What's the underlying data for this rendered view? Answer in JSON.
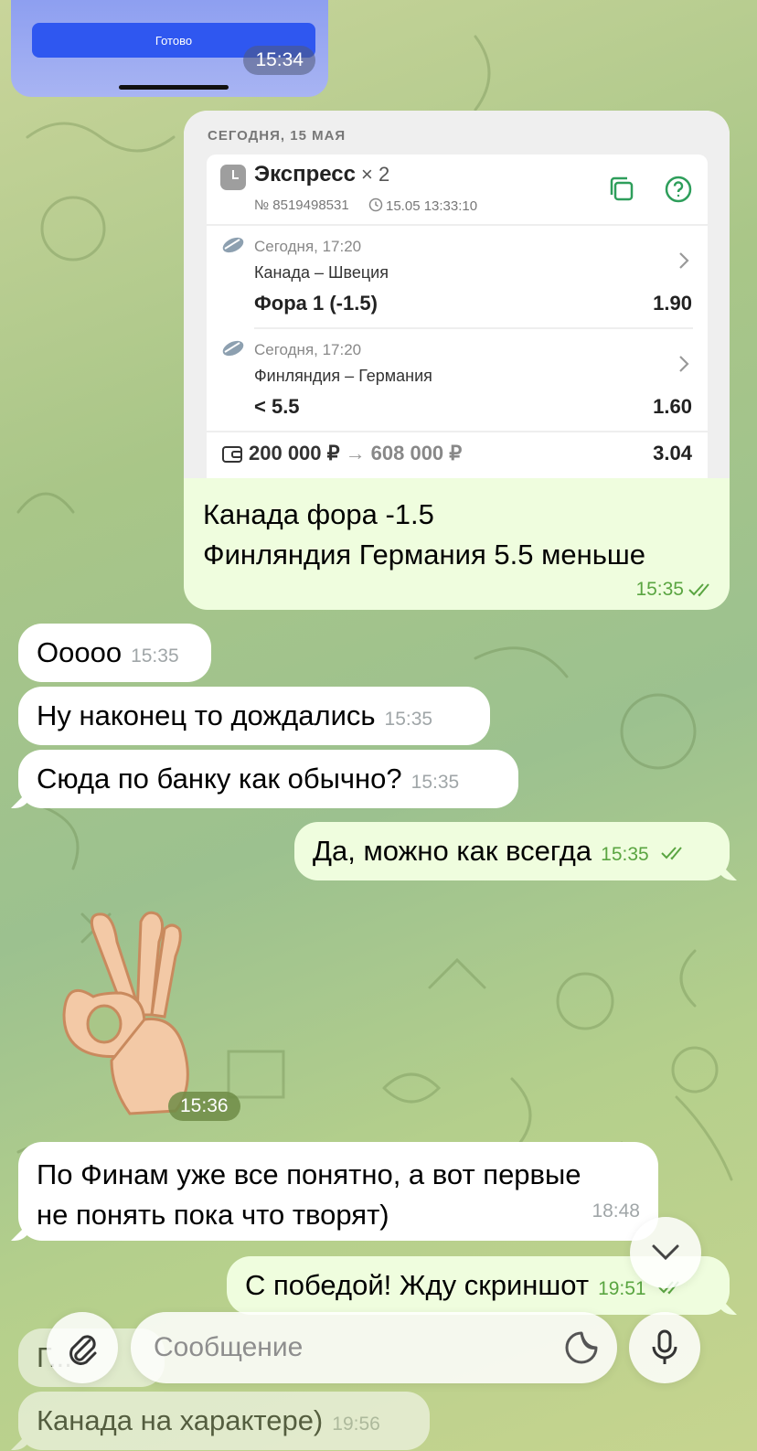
{
  "top_image": {
    "button_label": "Готово",
    "time": "15:34"
  },
  "bet_message": {
    "date_header": "СЕГОДНЯ, 15 МАЯ",
    "bet_type": "Экспресс",
    "multiplier": "× 2",
    "bet_number": "№ 8519498531",
    "bet_datetime": "15.05 13:33:10",
    "legs": [
      {
        "when": "Сегодня, 17:20",
        "match": "Канада – Швеция",
        "pick": "Фора 1 (-1.5)",
        "odds": "1.90"
      },
      {
        "when": "Сегодня, 17:20",
        "match": "Финляндия – Германия",
        "pick": "< 5.5",
        "odds": "1.60"
      }
    ],
    "stake": "200 000 ₽",
    "arrow": "→",
    "payout": "608 000 ₽",
    "total_odds": "3.04",
    "caption_line1": "Канада фора -1.5",
    "caption_line2": "Финляндия Германия 5.5 меньше",
    "time": "15:35"
  },
  "messages": [
    {
      "text": "Ооооо",
      "time": "15:35",
      "direction": "in"
    },
    {
      "text": "Ну наконец то дождались",
      "time": "15:35",
      "direction": "in"
    },
    {
      "text": "Сюда по банку как обычно?",
      "time": "15:35",
      "direction": "in"
    },
    {
      "text": "Да, можно как всегда",
      "time": "15:35",
      "direction": "out"
    },
    {
      "text_line1": "По Финам уже все понятно, а вот первые",
      "text_line2": "не понять пока что творят)",
      "time": "18:48",
      "direction": "in"
    },
    {
      "text": "С победой! Жду скриншот",
      "time": "19:51",
      "direction": "out"
    },
    {
      "text": "Г...",
      "direction": "in"
    },
    {
      "text": "Канада на характере)",
      "time": "19:56",
      "direction": "in"
    }
  ],
  "sticker": {
    "name": "ok-hand-sticker",
    "time": "15:36"
  },
  "composer": {
    "placeholder": "Сообщение"
  },
  "colors": {
    "incoming": "#ffffff",
    "outgoing": "#effdde",
    "accent_green": "#5aa541",
    "bet_green": "#2e9e5b"
  }
}
